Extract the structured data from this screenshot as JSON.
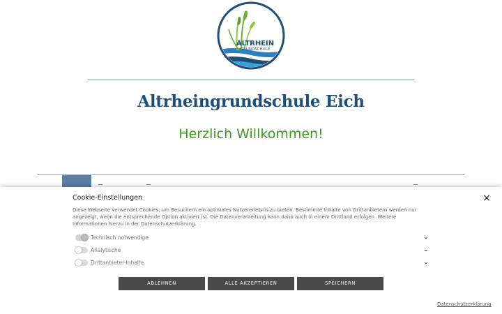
{
  "logo": {
    "name": "ALTRHEIN",
    "subname": "GRUNDSCHULE"
  },
  "site": {
    "title": "Altrheingrundschule Eich",
    "welcome": "Herzlich Willkommen!"
  },
  "cookie": {
    "title": "Cookie-Einstellungen",
    "close_label": "×",
    "text": "Diese Webseite verwendet Cookies, um Besuchern ein optimales Nutzererlebnis zu bieten. Bestimmte Inhalte von Drittanbietern werden nur angezeigt, wenn die entsprechende Option aktiviert ist. Die Datenverarbeitung kann dann auch in einem Drittland erfolgen. Weitere Informationen hierzu in der Datenschutzerklärung.",
    "options": [
      {
        "label": "Technisch notwendige",
        "enabled": true
      },
      {
        "label": "Analytische",
        "enabled": false
      },
      {
        "label": "Drittanbieter-Inhalte",
        "enabled": false
      }
    ],
    "buttons": {
      "decline": "ABLEHNEN",
      "accept_all": "ALLE AKZEPTIEREN",
      "save": "SPEICHERN"
    },
    "privacy_link": "Datenschutzerklärung"
  },
  "colors": {
    "title": "#1f4e79",
    "welcome": "#3b9a1e",
    "nav_active": "#5a7fa3",
    "button": "#4a4a4a"
  },
  "icons": {
    "close": "close-icon",
    "expand": "chevron-down-icon"
  }
}
